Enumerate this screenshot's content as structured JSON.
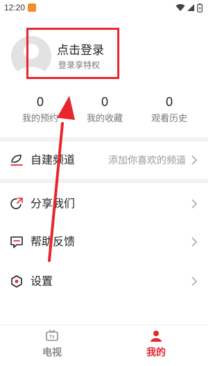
{
  "status_bar": {
    "time": "12:20",
    "icons": [
      "app-notification-icon",
      "wifi-icon",
      "cellular-signal-icon",
      "battery-icon"
    ]
  },
  "profile": {
    "avatar_icon": "default-avatar-icon",
    "login_title": "点击登录",
    "login_subtitle": "登录享特权",
    "highlight_color": "#e8262d"
  },
  "stats": [
    {
      "value": "0",
      "label": "我的预约"
    },
    {
      "value": "0",
      "label": "我的收藏"
    },
    {
      "value": "0",
      "label": "观看历史"
    }
  ],
  "menu": [
    {
      "icon": "channel-feather-icon",
      "label": "自建频道",
      "hint": "添加你喜欢的频道"
    },
    {
      "icon": "share-icon",
      "label": "分享我们",
      "hint": ""
    },
    {
      "icon": "feedback-icon",
      "label": "帮助反馈",
      "hint": ""
    },
    {
      "icon": "settings-icon",
      "label": "设置",
      "hint": ""
    }
  ],
  "bottom_nav": [
    {
      "icon": "tv-icon",
      "label": "电视",
      "active": false
    },
    {
      "icon": "user-icon",
      "label": "我的",
      "active": true
    }
  ],
  "colors": {
    "accent": "#e8262d",
    "inactive_nav": "#8a8a8a",
    "separator": "#f2f2f2"
  }
}
